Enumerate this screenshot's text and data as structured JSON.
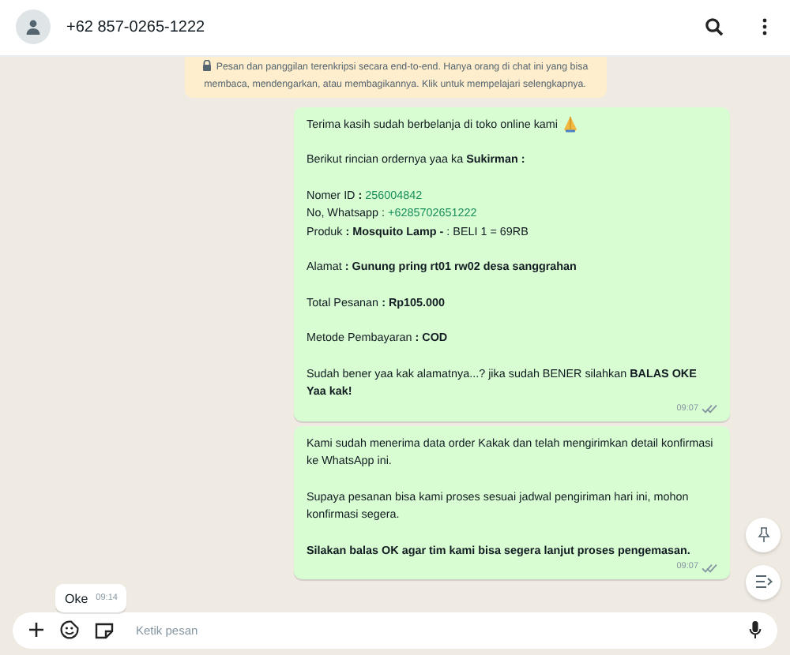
{
  "header": {
    "contact": "+62 857-0265-1222"
  },
  "notice": {
    "text": "Pesan dan panggilan terenkripsi secara end-to-end. Hanya orang di chat ini yang bisa membaca, mendengarkan, atau membagikannya. Klik untuk mempelajari selengkapnya."
  },
  "messages": [
    {
      "kind": "outgoing",
      "time": "09:07",
      "delivered": true,
      "paragraphs": [
        [
          {
            "text": "Terima kasih sudah berbelanja di toko online kami",
            "kind": "emoji"
          }
        ],
        [
          {
            "text": "Berikut rincian ordernya yaa ka **Sukirman :**"
          }
        ],
        [
          {
            "text": "Nomer ID **:** ",
            "link": "256004842"
          },
          {
            "text": "No, Whatsapp : ",
            "link": "+6285702651222"
          },
          {
            "text": "Produk **: Mosquito Lamp -** : BELI 1 = 69RB"
          }
        ],
        [
          {
            "text": "Alamat **: Gunung pring rt01 rw02 desa sanggrahan**"
          }
        ],
        [
          {
            "text": "Total Pesanan **: Rp105.000**"
          }
        ],
        [
          {
            "text": "Metode Pembayaran **: COD**"
          }
        ],
        [
          {
            "text": "Sudah bener yaa kak alamatnya...?  jika sudah BENER silahkan **BALAS OKE Yaa kak!**"
          }
        ]
      ]
    },
    {
      "kind": "outgoing",
      "time": "09:07",
      "delivered": true,
      "paragraphs": [
        [
          {
            "text": "Kami sudah menerima data order Kakak dan telah mengirimkan detail konfirmasi ke WhatsApp ini."
          }
        ],
        [
          {
            "text": "Supaya pesanan bisa kami proses sesuai jadwal pengiriman hari ini, mohon konfirmasi segera."
          }
        ],
        [
          {
            "text": "**Silakan balas OK agar tim kami bisa segera lanjut proses pengemasan.**"
          }
        ]
      ]
    },
    {
      "kind": "incoming",
      "time": "09:14",
      "paragraphs": [
        [
          {
            "text": "Oke"
          }
        ]
      ]
    }
  ],
  "composer": {
    "placeholder": "Ketik pesan"
  }
}
